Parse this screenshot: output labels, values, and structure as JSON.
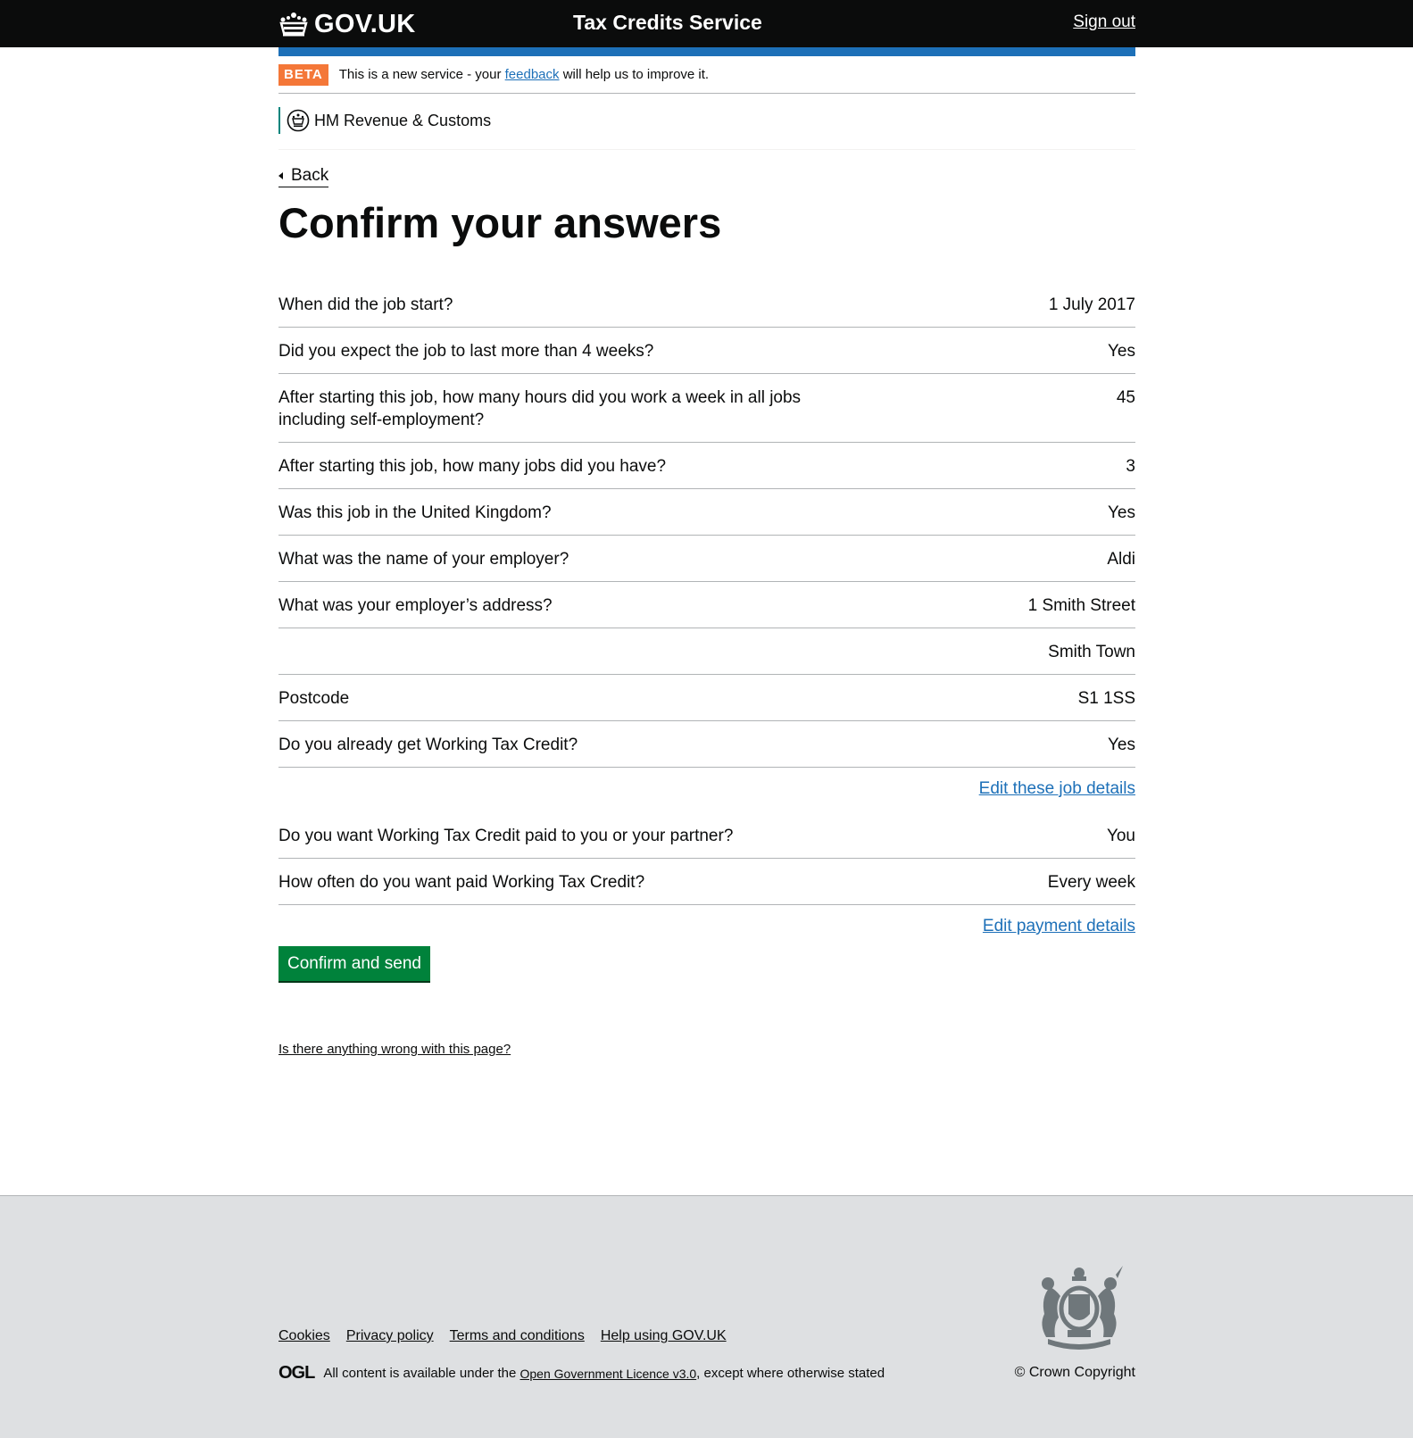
{
  "header": {
    "logo_text": "GOV.UK",
    "service_name": "Tax Credits Service",
    "sign_out": "Sign out"
  },
  "phase_banner": {
    "tag": "BETA",
    "text_before": "This is a new service - your",
    "link": "feedback",
    "text_after": "will help us to improve it."
  },
  "organisation": "HM Revenue & Customs",
  "back_link": "Back",
  "page_title": "Confirm your answers",
  "job_details": [
    {
      "question": "When did the job start?",
      "answer": "1 July 2017"
    },
    {
      "question": "Did you expect the job to last more than 4 weeks?",
      "answer": "Yes"
    },
    {
      "question": "After starting this job, how many hours did you work a week in all jobs including self-employment?",
      "answer": "45"
    },
    {
      "question": "After starting this job, how many jobs did you have?",
      "answer": "3"
    },
    {
      "question": "Was this job in the United Kingdom?",
      "answer": "Yes"
    },
    {
      "question": "What was the name of your employer?",
      "answer": "Aldi"
    },
    {
      "question": "What was your employer’s address?",
      "answer": "1 Smith Street"
    },
    {
      "question": "",
      "answer": "Smith Town"
    },
    {
      "question": "Postcode",
      "answer": "S1 1SS"
    },
    {
      "question": "Do you already get Working Tax Credit?",
      "answer": "Yes"
    }
  ],
  "edit_job_link": "Edit these job details",
  "payment_details": [
    {
      "question": "Do you want Working Tax Credit paid to you or your partner?",
      "answer": "You"
    },
    {
      "question": "How often do you want paid Working Tax Credit?",
      "answer": "Every week"
    }
  ],
  "edit_payment_link": "Edit payment details",
  "submit_button": "Confirm and send",
  "report_link": "Is there anything wrong with this page?",
  "footer": {
    "links": [
      "Cookies",
      "Privacy policy",
      "Terms and conditions",
      "Help using GOV.UK"
    ],
    "ogl_logo": "OGL",
    "licence_before": "All content is available under the",
    "licence_link": "Open Government Licence v3.0",
    "licence_after": ", except where otherwise stated",
    "copyright": "© Crown Copyright"
  },
  "colors": {
    "header_bg": "#0b0c0c",
    "brand_blue": "#1d70b8",
    "beta_orange": "#f47738",
    "button_green": "#00823b",
    "footer_bg": "#dee0e2",
    "hmrc_teal": "#00847c"
  }
}
